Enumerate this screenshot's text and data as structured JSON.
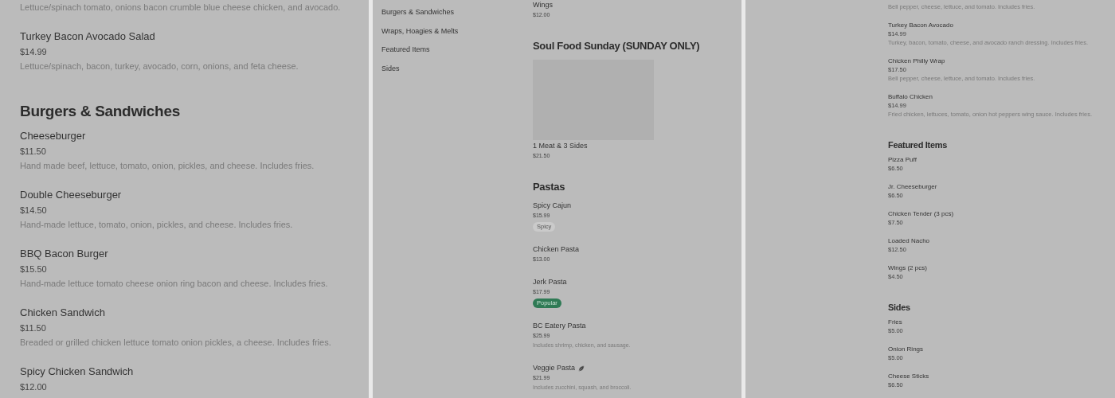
{
  "panels": [
    {
      "sections": [
        {
          "items": [
            {
              "description": "Lettuce/spinach tomato, onions bacon crumble blue cheese chicken, and avocado."
            },
            {
              "name": "Turkey Bacon Avocado Salad",
              "price": "$14.99",
              "description": "Lettuce/spinach, bacon, turkey, avocado, corn, onions, and feta cheese."
            }
          ]
        },
        {
          "title": "Burgers & Sandwiches",
          "items": [
            {
              "name": "Cheeseburger",
              "price": "$11.50",
              "description": "Hand made beef, lettuce, tomato, onion, pickles, and cheese. Includes fries."
            },
            {
              "name": "Double Cheeseburger",
              "price": "$14.50",
              "description": "Hand-made lettuce, tomato, onion, pickles, and cheese. Includes fries."
            },
            {
              "name": "BBQ Bacon Burger",
              "price": "$15.50",
              "description": "Hand-made lettuce tomato cheese onion ring bacon and cheese. Includes fries."
            },
            {
              "name": "Chicken Sandwich",
              "price": "$11.50",
              "description": "Breaded or grilled chicken lettuce tomato onion pickles, a cheese. Includes fries."
            },
            {
              "name": "Spicy Chicken Sandwich",
              "price": "$12.00"
            }
          ]
        }
      ]
    },
    {
      "nav": [
        {
          "label": "Burgers & Sandwiches"
        },
        {
          "label": "Wraps, Hoagies & Melts"
        },
        {
          "label": "Featured Items"
        },
        {
          "label": "Sides"
        }
      ],
      "sections": [
        {
          "items": [
            {
              "name": "Wings",
              "price": "$12.00"
            }
          ]
        },
        {
          "title": "Soul Food Sunday (SUNDAY ONLY)",
          "items": [
            {
              "image": true,
              "name": "1 Meat & 3 Sides",
              "price": "$21.50"
            }
          ]
        },
        {
          "title": "Pastas",
          "items": [
            {
              "name": "Spicy Cajun",
              "price": "$15.99",
              "tags": [
                {
                  "label": "Spicy",
                  "kind": "plain"
                }
              ]
            },
            {
              "name": "Chicken Pasta",
              "price": "$13.00"
            },
            {
              "name": "Jerk Pasta",
              "price": "$17.99",
              "tags": [
                {
                  "label": "Popular",
                  "kind": "popular"
                }
              ]
            },
            {
              "name": "BC Eatery Pasta",
              "price": "$25.99",
              "description": "Includes shrimp, chicken, and sausage."
            },
            {
              "name": "Veggie Pasta",
              "vegetarian": true,
              "price": "$21.99",
              "description": "Includes zucchini, squash, and broccoli."
            }
          ]
        }
      ]
    },
    {
      "sections": [
        {
          "items": [
            {
              "description": "Bell pepper, cheese, lettuce, and tomato. Includes fries."
            },
            {
              "name": "Turkey Bacon Avocado",
              "price": "$14.99",
              "description": "Turkey, bacon, tomato, cheese, and avocado ranch dressing. Includes fries."
            },
            {
              "name": "Chicken Philly Wrap",
              "price": "$17.50",
              "description": "Bell pepper, cheese, lettuce, and tomato. Includes fries."
            },
            {
              "name": "Buffalo Chicken",
              "price": "$14.99",
              "description": "Fried chicken, lettuces, tomato, onion hot peppers wing sauce. Includes fries."
            }
          ]
        },
        {
          "title": "Featured Items",
          "items": [
            {
              "name": "Pizza Puff",
              "price": "$6.50"
            },
            {
              "name": "Jr. Cheeseburger",
              "price": "$6.50"
            },
            {
              "name": "Chicken Tender (3 pcs)",
              "price": "$7.50"
            },
            {
              "name": "Loaded Nacho",
              "price": "$12.50"
            },
            {
              "name": "Wings (2 pcs)",
              "price": "$4.50"
            }
          ]
        },
        {
          "title": "Sides",
          "items": [
            {
              "name": "Fries",
              "price": "$5.00"
            },
            {
              "name": "Onion Rings",
              "price": "$5.00"
            },
            {
              "name": "Cheese Sticks",
              "price": "$6.50"
            }
          ]
        }
      ]
    }
  ]
}
